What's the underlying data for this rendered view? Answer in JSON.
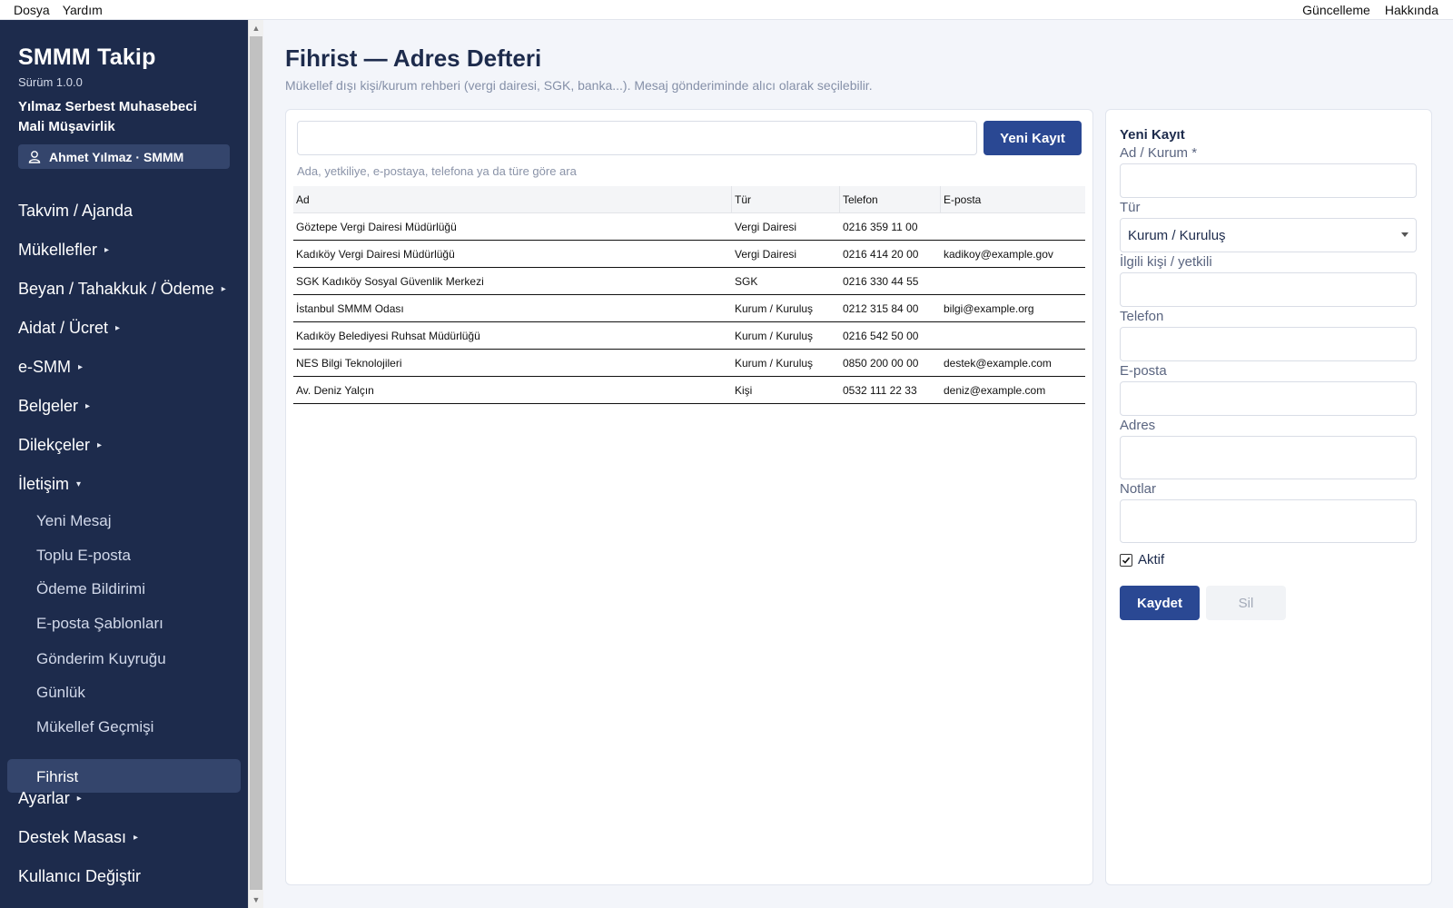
{
  "menubar": {
    "left": [
      "Dosya",
      "Yardım"
    ],
    "right": [
      "Güncelleme",
      "Hakkında"
    ]
  },
  "sidebar": {
    "app_title": "SMMM Takip",
    "version": "Sürüm 1.0.0",
    "firm_line1": "Yılmaz Serbest Muhasebeci",
    "firm_line2": "Mali Müşavirlik",
    "user": "Ahmet Yılmaz · SMMM",
    "user_icon": "user-icon",
    "nav": [
      {
        "label": "Takvim / Ajanda",
        "arrow": ""
      },
      {
        "label": "Mükellefler",
        "arrow": "▸"
      },
      {
        "label": "Beyan / Tahakkuk / Ödeme",
        "arrow": "▸"
      },
      {
        "label": "Aidat / Ücret",
        "arrow": "▸"
      },
      {
        "label": "e-SMM",
        "arrow": "▸"
      },
      {
        "label": "Belgeler",
        "arrow": "▸"
      },
      {
        "label": "Dilekçeler",
        "arrow": "▸"
      },
      {
        "label": "İletişim",
        "arrow": "▾"
      }
    ],
    "sub": [
      "Yeni Mesaj",
      "Toplu E-posta",
      "Ödeme Bildirimi",
      "E-posta Şablonları",
      "Gönderim Kuyruğu",
      "Günlük",
      "Mükellef Geçmişi"
    ],
    "active": "Fihrist",
    "nav_after": [
      {
        "label": "Ayarlar",
        "arrow": "▸"
      },
      {
        "label": "Destek Masası",
        "arrow": "▸"
      },
      {
        "label": "Kullanıcı Değiştir",
        "arrow": ""
      }
    ]
  },
  "page": {
    "title": "Fihrist — Adres Defteri",
    "subtitle": "Mükellef dışı kişi/kurum rehberi (vergi dairesi, SGK, banka...). Mesaj gönderiminde alıcı olarak seçilebilir."
  },
  "list": {
    "search_value": "",
    "search_hint": "Ada, yetkiliye, e-postaya, telefona ya da türe göre ara",
    "new_button": "Yeni Kayıt",
    "columns": [
      "Ad",
      "Tür",
      "Telefon",
      "E-posta"
    ],
    "rows": [
      [
        "Göztepe Vergi Dairesi Müdürlüğü",
        "Vergi Dairesi",
        "0216 359 11 00",
        ""
      ],
      [
        "Kadıköy Vergi Dairesi Müdürlüğü",
        "Vergi Dairesi",
        "0216 414 20 00",
        "kadikoy@example.gov"
      ],
      [
        "SGK Kadıköy Sosyal Güvenlik Merkezi",
        "SGK",
        "0216 330 44 55",
        ""
      ],
      [
        "İstanbul SMMM Odası",
        "Kurum / Kuruluş",
        "0212 315 84 00",
        "bilgi@example.org"
      ],
      [
        "Kadıköy Belediyesi Ruhsat Müdürlüğü",
        "Kurum / Kuruluş",
        "0216 542 50 00",
        ""
      ],
      [
        "NES Bilgi Teknolojileri",
        "Kurum / Kuruluş",
        "0850 200 00 00",
        "destek@example.com"
      ],
      [
        "Av. Deniz Yalçın",
        "Kişi",
        "0532 111 22 33",
        "deniz@example.com"
      ]
    ]
  },
  "form": {
    "title": "Yeni Kayıt",
    "label_name": "Ad / Kurum *",
    "label_type": "Tür",
    "type_value": "Kurum / Kuruluş",
    "label_contact": "İlgili kişi / yetkili",
    "label_phone": "Telefon",
    "label_email": "E-posta",
    "label_address": "Adres",
    "label_notes": "Notlar",
    "active_label": "Aktif",
    "active_checked": true,
    "save_button": "Kaydet",
    "delete_button": "Sil"
  }
}
